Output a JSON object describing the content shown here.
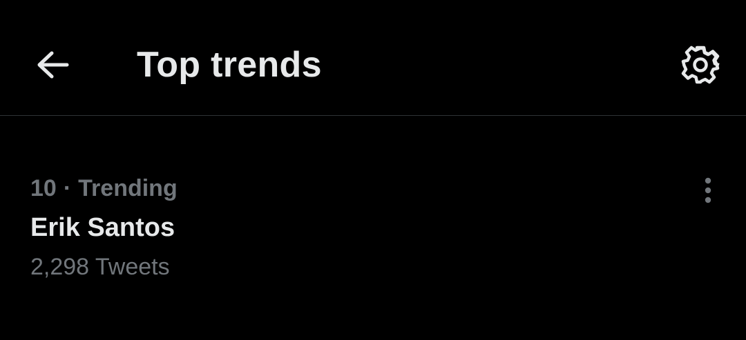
{
  "header": {
    "title": "Top trends",
    "back_icon": "arrow-left-icon",
    "settings_icon": "gear-icon"
  },
  "trends": [
    {
      "rank": "10",
      "separator": "·",
      "category": "Trending",
      "name": "Erik Santos",
      "tweet_count": "2,298 Tweets",
      "more_icon": "more-vertical-icon"
    }
  ],
  "colors": {
    "background": "#000000",
    "primary_text": "#e7e9ea",
    "secondary_text": "#71767b",
    "divider": "#2f3336"
  }
}
